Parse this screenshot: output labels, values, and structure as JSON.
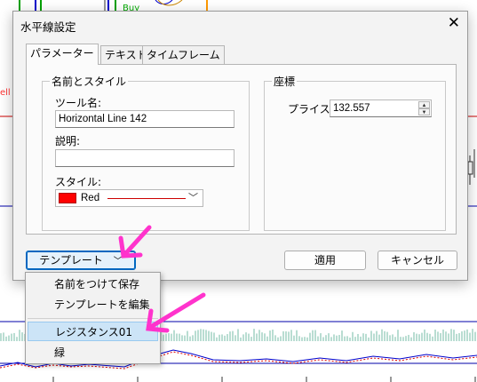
{
  "chart": {
    "buy_label": "Buy",
    "sell_label": "ell"
  },
  "dialog": {
    "title": "水平線設定",
    "tabs": [
      {
        "label": "パラメーター",
        "active": true
      },
      {
        "label": "テキスト",
        "active": false
      },
      {
        "label": "タイムフレーム",
        "active": false
      }
    ],
    "name_style_group": {
      "label": "名前とスタイル",
      "tool_name_label": "ツール名:",
      "tool_name_value": "Horizontal Line 142",
      "description_label": "説明:",
      "description_value": "",
      "style_label": "スタイル:",
      "style_color_name": "Red",
      "style_color": "#ff0000"
    },
    "coords_group": {
      "label": "座標",
      "price_label": "プライス:",
      "price_value": "132.557"
    },
    "template_button": "テンプレート",
    "apply_button": "適用",
    "cancel_button": "キャンセル"
  },
  "template_menu": {
    "items": [
      "名前をつけて保存",
      "テンプレートを編集",
      "レジスタンス01",
      "緑"
    ],
    "highlighted_index": 2
  },
  "annotation_color": "#ff33cc"
}
